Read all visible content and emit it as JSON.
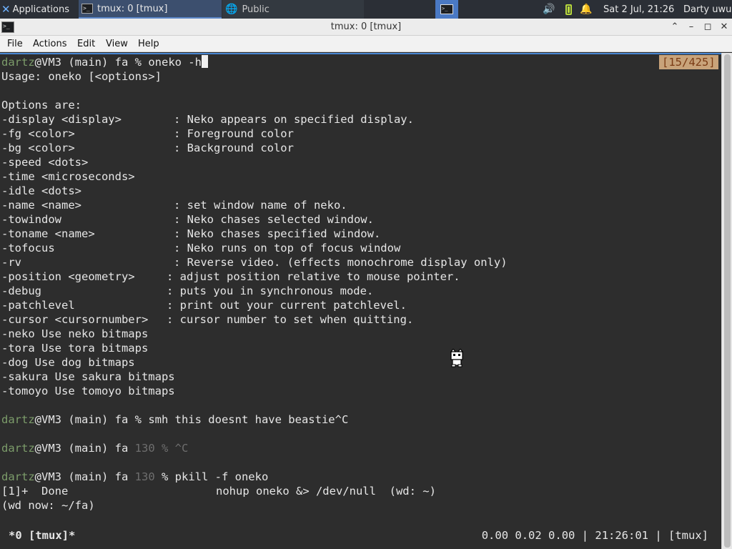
{
  "panel": {
    "applications_label": "Applications",
    "tasks": [
      {
        "label": "tmux: 0 [tmux]",
        "icon": "terminal-icon"
      },
      {
        "label": "Public",
        "icon": "globe-icon"
      }
    ],
    "clock": "Sat  2 Jul, 21:26",
    "user": "Darty uwu",
    "tray_icons": [
      "volume-icon",
      "battery-icon",
      "bell-icon"
    ]
  },
  "window": {
    "title": "tmux: 0 [tmux]",
    "buttons": {
      "up": "⌃",
      "minimize": "–",
      "maximize": "◻",
      "close": "✕"
    }
  },
  "menu": {
    "file": "File",
    "actions": "Actions",
    "edit": "Edit",
    "view": "View",
    "help": "Help"
  },
  "terminal": {
    "prompt_user": "dartz",
    "prompt_host": "@VM3 (main) fa ",
    "first_cmd": "% oneko -h",
    "scroll_counter": "[15/425]",
    "usage": "Usage: oneko [<options>]",
    "options_header": "Options are:",
    "options": [
      {
        "flag": "-display <display>",
        "desc": ": Neko appears on specified display.",
        "col": 1
      },
      {
        "flag": "-fg <color>",
        "desc": ": Foreground color",
        "col": 1
      },
      {
        "flag": "-bg <color>",
        "desc": ": Background color",
        "col": 1
      },
      {
        "flag": "-speed <dots>",
        "desc": "",
        "col": 1
      },
      {
        "flag": "-time <microseconds>",
        "desc": "",
        "col": 1
      },
      {
        "flag": "-idle <dots>",
        "desc": "",
        "col": 1
      },
      {
        "flag": "-name <name>",
        "desc": ": set window name of neko.",
        "col": 1
      },
      {
        "flag": "-towindow",
        "desc": ": Neko chases selected window.",
        "col": 1
      },
      {
        "flag": "-toname <name>",
        "desc": ": Neko chases specified window.",
        "col": 1
      },
      {
        "flag": "-tofocus",
        "desc": ": Neko runs on top of focus window",
        "col": 1
      },
      {
        "flag": "-rv",
        "desc": ": Reverse video. (effects monochrome display only)",
        "col": 1
      },
      {
        "flag": "-position <geometry>",
        "desc": ": adjust position relative to mouse pointer.",
        "col": 2
      },
      {
        "flag": "-debug",
        "desc": ": puts you in synchronous mode.",
        "col": 2
      },
      {
        "flag": "-patchlevel",
        "desc": ": print out your current patchlevel.",
        "col": 2
      },
      {
        "flag": "-cursor <cursornumber>",
        "desc": ": cursor number to set when quitting.",
        "col": 2
      },
      {
        "flag": "-neko Use neko bitmaps",
        "desc": "",
        "col": 1
      },
      {
        "flag": "-tora Use tora bitmaps",
        "desc": "",
        "col": 1
      },
      {
        "flag": "-dog Use dog bitmaps",
        "desc": "",
        "col": 1
      },
      {
        "flag": "-sakura Use sakura bitmaps",
        "desc": "",
        "col": 1
      },
      {
        "flag": "-tomoyo Use tomoyo bitmaps",
        "desc": "",
        "col": 1
      }
    ],
    "cmd2": "% smh this doesnt have beastie^C",
    "cmd3_code": "130",
    "cmd3_rest": " % ^C",
    "cmd4_code": "130",
    "cmd4_rest": " % pkill -f oneko",
    "job_line_left": "[1]+  Done",
    "job_line_right": "nohup oneko &> /dev/null  (wd: ~)",
    "wd_now": "(wd now: ~/fa)"
  },
  "statusbar": {
    "left": "*0 [tmux]*",
    "right": "0.00 0.02 0.00 | 21:26:01 | [tmux]"
  }
}
